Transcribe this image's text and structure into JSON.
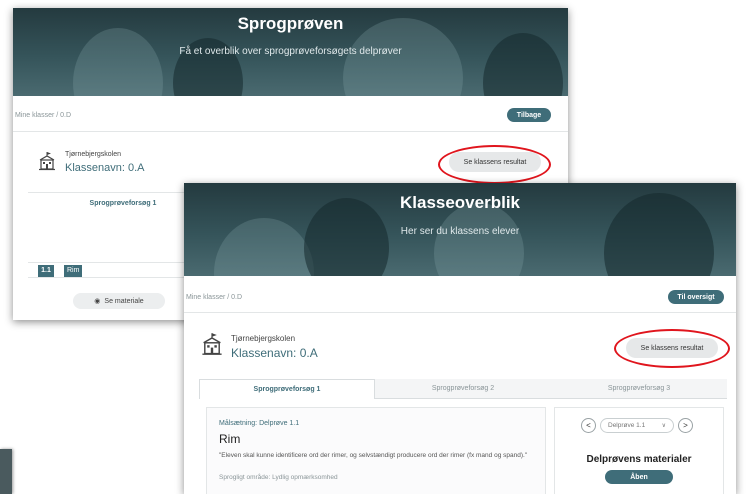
{
  "back_screen": {
    "hero_title": "Sprogprøven",
    "hero_subtitle": "Få et overblik over sprogprøveforsøgets delprøver",
    "breadcrumb": "Mine klasser / 0.D",
    "back_button": "Tilbage",
    "school": "Tjørnebjergskolen",
    "class_label": "Klassenavn: 0.A",
    "results_button": "Se klassens resultat",
    "attempt_title": "Sprogprøveforsøg 1",
    "item_number": "1.1",
    "item_label": "Rim",
    "see_material_button": "Se materiale"
  },
  "front_screen": {
    "hero_title": "Klasseoverblik",
    "hero_subtitle": "Her ser du klassens elever",
    "breadcrumb": "Mine klasser / 0.D",
    "overview_button": "Til oversigt",
    "school": "Tjørnebjergskolen",
    "class_label": "Klassenavn: 0.A",
    "results_button": "Se klassens resultat",
    "tabs": [
      {
        "label": "Sprogprøveforsøg 1",
        "active": true
      },
      {
        "label": "Sprogprøveforsøg 2",
        "active": false
      },
      {
        "label": "Sprogprøveforsøg 3",
        "active": false
      }
    ],
    "goal_label": "Målsætning: Delprøve 1.1",
    "goal_title": "Rim",
    "goal_text": "\"Eleven skal kunne identificere ord der rimer, og selvstændigt producere ord der rimer (fx mand og spand).\"",
    "area_text": "Sprogligt område: Lydlig opmærksomhed",
    "subtest_select": "Delprøve 1.1",
    "materials_heading": "Delprøvens materialer",
    "open_button": "Åben"
  },
  "colors": {
    "accent": "#3f6d79",
    "highlight_ring": "#e0151d"
  }
}
